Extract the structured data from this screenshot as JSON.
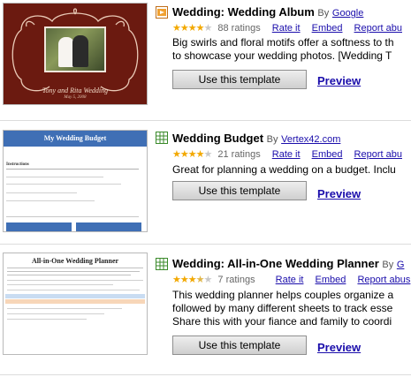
{
  "templates": [
    {
      "title": "Wedding: Wedding Album",
      "by": "By",
      "author": "Google",
      "stars": 4,
      "ratings": "88 ratings",
      "rate_it": "Rate it",
      "embed": "Embed",
      "report": "Report abu",
      "desc_line1": "Big swirls and floral motifs offer a softness to th",
      "desc_line2": "to showcase your wedding photos. [Wedding T",
      "button": "Use this template",
      "preview": "Preview",
      "thumb_caption_names": "Tony and Rita Wedding",
      "thumb_caption_date": "May 5, 2008",
      "icon": "presentation-icon",
      "accent": "#7a1f12"
    },
    {
      "title": "Wedding Budget",
      "by": "By",
      "author": "Vertex42.com",
      "stars": 4,
      "ratings": "21 ratings",
      "rate_it": "Rate it",
      "embed": "Embed",
      "report": "Report abu",
      "desc_line1": "Great for planning a wedding on a budget. Inclu",
      "button": "Use this template",
      "preview": "Preview",
      "thumb_header": "My Wedding Budget",
      "thumb_instructions": "Instructions",
      "icon": "spreadsheet-icon",
      "accent": "#3f6fb5"
    },
    {
      "title": "Wedding: All-in-One Wedding Planner",
      "by": "By",
      "author": "G",
      "stars": 3.5,
      "ratings": "7 ratings",
      "rate_it": "Rate it",
      "embed": "Embed",
      "report": "Report abus",
      "desc_line1": "This wedding planner helps couples organize a",
      "desc_line2": "followed by many different sheets to track esse",
      "desc_line3": "Share this with your fiance and family to coordi",
      "button": "Use this template",
      "preview": "Preview",
      "thumb_header": "All-in-One Wedding Planner",
      "icon": "spreadsheet-icon"
    }
  ]
}
